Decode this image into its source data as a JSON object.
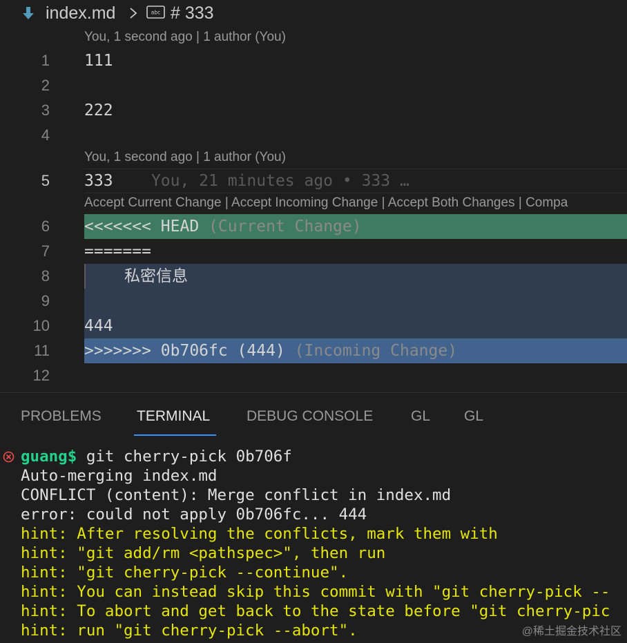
{
  "breadcrumb": {
    "file": "index.md",
    "symbol": "# 333"
  },
  "editor": {
    "codelens_blame_1": "You, 1 second ago | 1 author (You)",
    "codelens_blame_2": "You, 1 second ago | 1 author (You)",
    "codelens_actions": [
      "Accept Current Change",
      "Accept Incoming Change",
      "Accept Both Changes",
      "Compa"
    ],
    "codelens_separator": " | ",
    "line_numbers": [
      "1",
      "2",
      "3",
      "4",
      "5",
      "6",
      "7",
      "8",
      "9",
      "10",
      "11",
      "12"
    ],
    "lines": {
      "l1": "111",
      "l3": "222",
      "l5": "333",
      "l5_blame": "You, 21 minutes ago • 333 …",
      "l6_marker": "<<<<<<< HEAD",
      "l6_label": "(Current Change)",
      "l7": "=======",
      "l8": "私密信息",
      "l10": "444",
      "l11_marker": ">>>>>>> 0b706fc (444)",
      "l11_label": "(Incoming Change)"
    },
    "colors": {
      "current_change": "#3f7a63",
      "incoming_body": "#303c50",
      "incoming_change": "#41638e"
    }
  },
  "panel": {
    "tabs": [
      "PROBLEMS",
      "TERMINAL",
      "DEBUG CONSOLE",
      "GL",
      "GL"
    ],
    "active_tab": "TERMINAL"
  },
  "terminal": {
    "prompt": "guang$",
    "command": " git cherry-pick 0b706f",
    "output": [
      "Auto-merging index.md",
      "CONFLICT (content): Merge conflict in index.md",
      "error: could not apply 0b706fc... 444"
    ],
    "hints": [
      "hint: After resolving the conflicts, mark them with",
      "hint: \"git add/rm <pathspec>\", then run",
      "hint: \"git cherry-pick --continue\".",
      "hint: You can instead skip this commit with \"git cherry-pick --",
      "hint: To abort and get back to the state before \"git cherry-pic",
      "hint: run \"git cherry-pick --abort\"."
    ],
    "prompt_color": "#23d18b",
    "hint_color": "#e5e510"
  },
  "watermark": "@稀土掘金技术社区"
}
